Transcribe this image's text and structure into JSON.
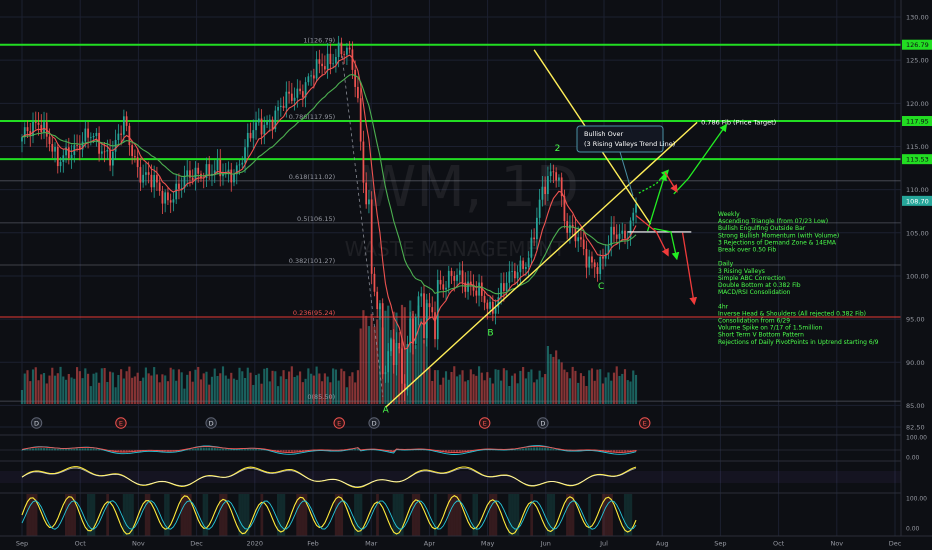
{
  "chart_data": {
    "type": "candlestick",
    "watermark": "WM, 1D",
    "watermark_sub": "WASTE MANAGEMENT",
    "x_ticks": [
      "Sep",
      "Oct",
      "Nov",
      "Dec",
      "2020",
      "Feb",
      "Mar",
      "Apr",
      "May",
      "Jun",
      "Jul",
      "Aug",
      "Sep",
      "Oct",
      "Nov",
      "Dec"
    ],
    "y_ticks": [
      "130.00",
      "125.00",
      "120.00",
      "115.00",
      "110.00",
      "105.00",
      "100.00",
      "95.00",
      "90.00",
      "85.00",
      "82.50"
    ],
    "ylim": [
      81,
      131
    ],
    "price_axis_tags": [
      {
        "text": "126.79",
        "value": 126.79,
        "color": "#22dd22"
      },
      {
        "text": "117.95",
        "value": 117.95,
        "color": "#22dd22"
      },
      {
        "text": "113.53",
        "value": 113.53,
        "color": "#22dd22"
      },
      {
        "text": "108.70",
        "value": 108.7,
        "color": "#26a69a"
      }
    ],
    "horizontal_levels": [
      {
        "value": 126.79,
        "kind": "resistance"
      },
      {
        "value": 117.95,
        "kind": "resistance"
      },
      {
        "value": 113.53,
        "kind": "resistance"
      },
      {
        "value": 95.24,
        "kind": "support"
      }
    ],
    "fib_levels": [
      {
        "label": "1(126.79)",
        "value": 126.79
      },
      {
        "label": "0.786(117.95)",
        "value": 117.95
      },
      {
        "label": "0.618(111.02)",
        "value": 111.02
      },
      {
        "label": "0.5(106.15)",
        "value": 106.15
      },
      {
        "label": "0.382(101.27)",
        "value": 101.27
      },
      {
        "label": "0.236(95.24)",
        "value": 95.24
      },
      {
        "label": "0(85.50)",
        "value": 85.5
      }
    ],
    "trend_lines": [
      {
        "from": [
          8.8,
          126.2
        ],
        "to": [
          10.8,
          106.0
        ]
      },
      {
        "from": [
          6.25,
          84.8
        ],
        "to": [
          11.6,
          117.8
        ]
      }
    ],
    "price_target_label": "0.786 Fib (Price Target)",
    "wave_labels": [
      {
        "text": "A",
        "x": 6.25,
        "y": 84.2
      },
      {
        "text": "B",
        "x": 8.05,
        "y": 93.1
      },
      {
        "text": "2",
        "x": 9.2,
        "y": 114.5
      },
      {
        "text": "C",
        "x": 9.95,
        "y": 98.5
      }
    ],
    "callout": {
      "line1": "Bullish Over",
      "line2": "(3 Rising Valleys Trend Line)"
    },
    "annotation_lines": [
      "Weekly",
      "Ascending Triangle (from 07/23 Low)",
      "Bullish Engulfing Outside Bar",
      "Strong Bullish Momentum (with Volume)",
      "3 Rejections of Demand Zone & 14EMA",
      "Break over 0.50 Fib",
      "",
      "Daily",
      "3 Rising Valleys",
      "Simple ABC Correction",
      "Double Bottom at 0.382 Fib",
      "MACD/RSI Consolidation",
      "",
      "4hr",
      "Inverse Head & Shoulders (All rejected 0.382 Fib)",
      "Consolidation from 6/29",
      "Volume Spike on 7/17 of 1.5million",
      "Short Term V Bottom Pattern",
      "Rejections of Daily PivotPoints in Uptrend starting 6/9"
    ],
    "event_markers": [
      {
        "text": "D",
        "x": 0.25
      },
      {
        "text": "E",
        "x": 1.7
      },
      {
        "text": "D",
        "x": 3.25
      },
      {
        "text": "E",
        "x": 5.45
      },
      {
        "text": "D",
        "x": 6.05
      },
      {
        "text": "E",
        "x": 7.95
      },
      {
        "text": "D",
        "x": 8.95
      },
      {
        "text": "E",
        "x": 10.7
      }
    ],
    "osc1_ticks": [
      "100.00",
      "0.00"
    ],
    "osc2_ticks": [
      "100.00",
      "0.00"
    ],
    "colors": {
      "background": "#0d0f14",
      "up": "#26a69a",
      "down": "#ef5350",
      "level": "#22dd22",
      "trend": "#ffee58",
      "ema_fast": "#ef5350",
      "ema_slow": "#4caf50",
      "annotation": "#4cff4c"
    }
  }
}
